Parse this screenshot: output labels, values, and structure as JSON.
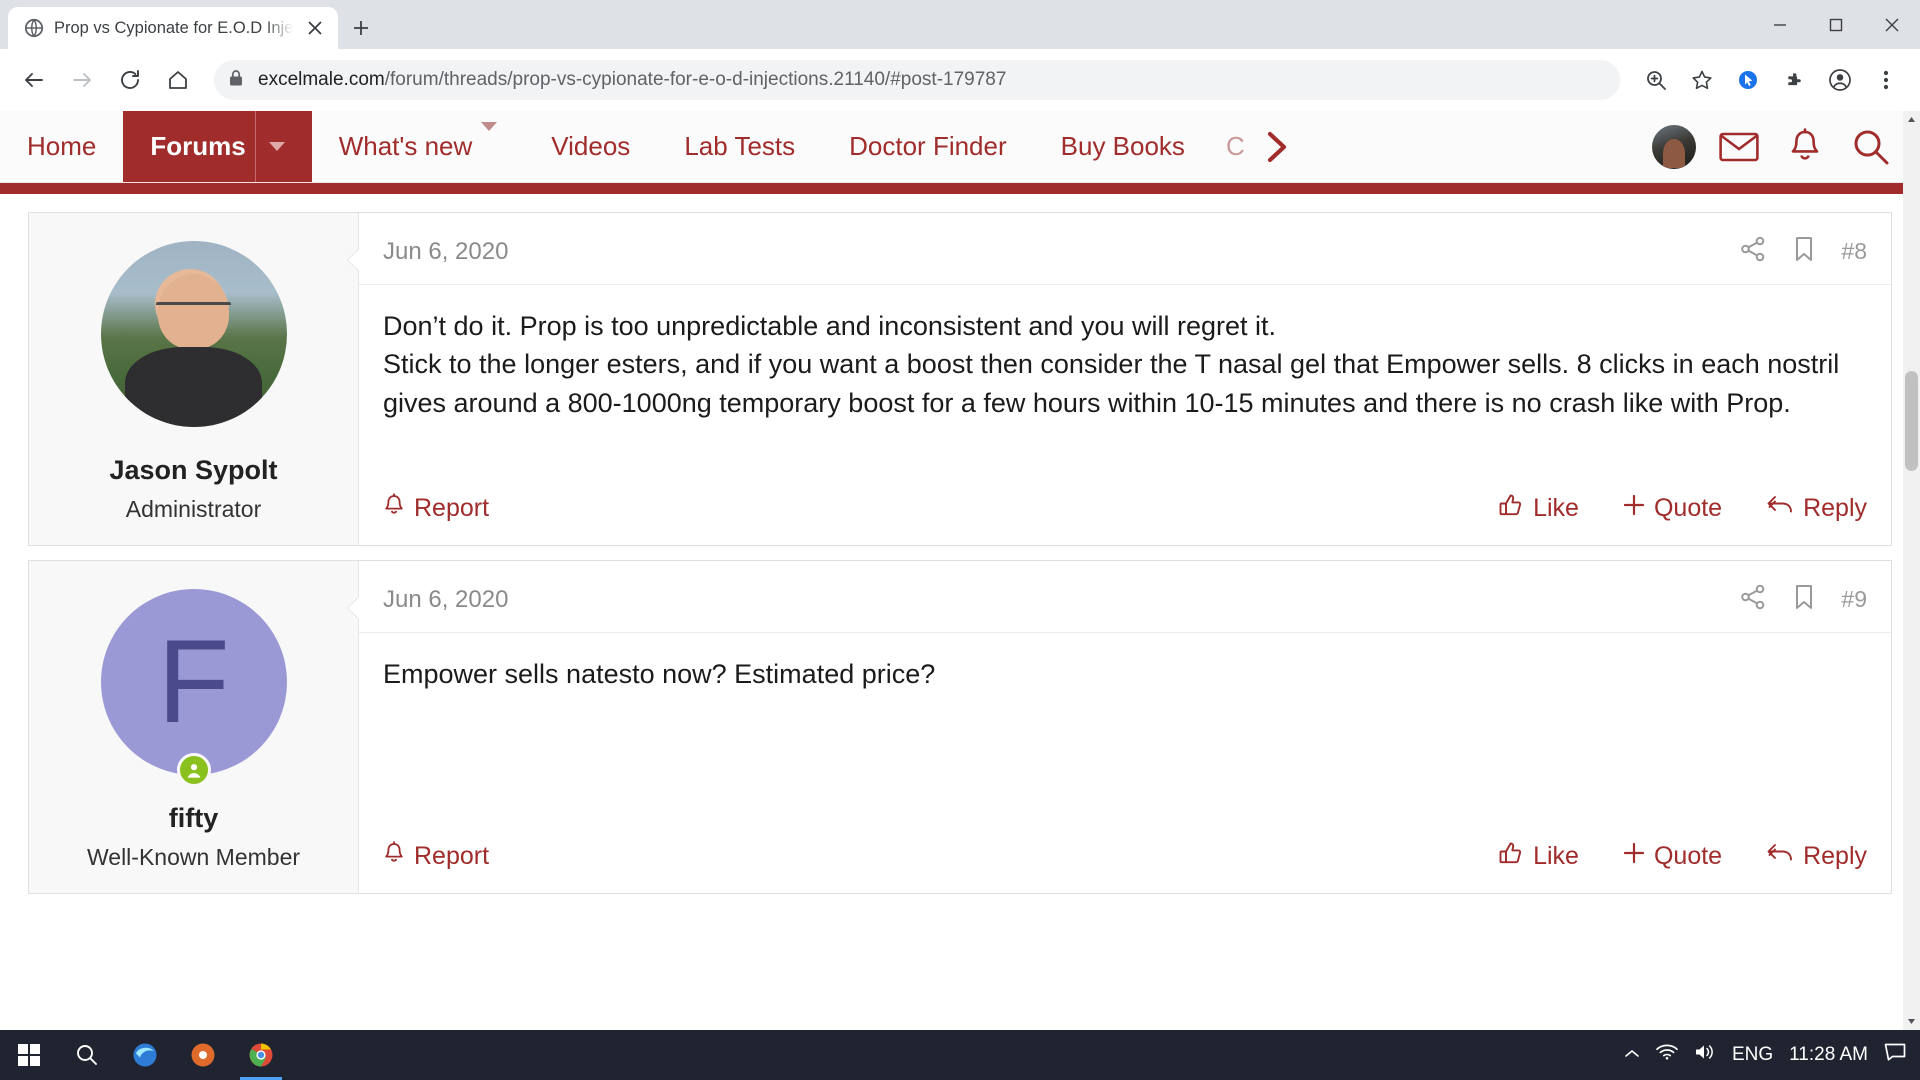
{
  "browser": {
    "tab": {
      "title": "Prop vs Cypionate for E.O.D Injec",
      "favicon_name": "globe-icon",
      "close_name": "close-icon"
    },
    "new_tab_label": "+",
    "window_controls": {
      "minimize": "—",
      "maximize": "☐",
      "close": "✕"
    },
    "toolbar": {
      "back": "back-arrow-icon",
      "forward": "forward-arrow-icon",
      "reload": "reload-icon",
      "home": "home-icon",
      "lock": "lock-icon",
      "url_domain": "excelmale.com",
      "url_path": "/forum/threads/prop-vs-cypionate-for-e-o-d-injections.21140/#post-179787",
      "zoom_icon": "zoom-in-icon",
      "star_icon": "bookmark-star-icon",
      "extension_icon": "extensions-puzzle-icon",
      "profile_icon": "profile-avatar-icon",
      "menu_icon": "three-dot-menu-icon"
    }
  },
  "site": {
    "accent_color": "#a02c2c",
    "nav": [
      {
        "label": "Home",
        "has_caret": false,
        "active": false
      },
      {
        "label": "Forums",
        "has_caret": true,
        "active": true
      },
      {
        "label": "What's new",
        "has_caret": true,
        "active": false
      },
      {
        "label": "Videos",
        "has_caret": false,
        "active": false
      },
      {
        "label": "Lab Tests",
        "has_caret": false,
        "active": false
      },
      {
        "label": "Doctor Finder",
        "has_caret": false,
        "active": false
      },
      {
        "label": "Buy Books",
        "has_caret": false,
        "active": false
      },
      {
        "label": "C",
        "has_caret": false,
        "active": false
      }
    ],
    "nav_overflow_icon": "chevron-right-icon",
    "nav_right": [
      {
        "name": "user-avatar",
        "icon": "avatar-icon"
      },
      {
        "name": "inbox",
        "icon": "envelope-icon"
      },
      {
        "name": "alerts",
        "icon": "bell-icon"
      },
      {
        "name": "search",
        "icon": "search-icon"
      }
    ]
  },
  "posts": [
    {
      "date": "Jun 6, 2020",
      "number": "#8",
      "share_icon": "share-icon",
      "bookmark_icon": "bookmark-icon",
      "author": {
        "name": "Jason Sypolt",
        "title": "Administrator",
        "avatar_type": "photo",
        "online": false
      },
      "lines": [
        "Don’t do it. Prop is too unpredictable and inconsistent and you will regret it.",
        "Stick to the longer esters, and if you want a boost then consider the T nasal gel that Empower sells. 8 clicks in each nostril gives around a 800-1000ng temporary boost for a few hours within 10-15 minutes and there is no crash like with Prop."
      ],
      "actions": {
        "report": "Report",
        "like": "Like",
        "quote": "Quote",
        "reply": "Reply"
      }
    },
    {
      "date": "Jun 6, 2020",
      "number": "#9",
      "share_icon": "share-icon",
      "bookmark_icon": "bookmark-icon",
      "author": {
        "name": "fifty",
        "title": "Well-Known Member",
        "avatar_type": "letter",
        "avatar_letter": "F",
        "online": true
      },
      "lines": [
        "Empower sells natesto now? Estimated price?"
      ],
      "actions": {
        "report": "Report",
        "like": "Like",
        "quote": "Quote",
        "reply": "Reply"
      }
    }
  ],
  "taskbar": {
    "start_icon": "windows-start-icon",
    "items": [
      {
        "name": "search",
        "icon": "search-icon"
      },
      {
        "name": "edge",
        "icon": "edge-browser-icon"
      },
      {
        "name": "media-player",
        "icon": "media-player-icon"
      },
      {
        "name": "chrome",
        "icon": "chrome-browser-icon"
      }
    ],
    "tray": {
      "chevron": "show-hidden-icons-icon",
      "wifi": "wifi-icon",
      "volume": "volume-icon",
      "language": "ENG",
      "time": "11:28 AM",
      "notifications": "notification-center-icon"
    }
  }
}
